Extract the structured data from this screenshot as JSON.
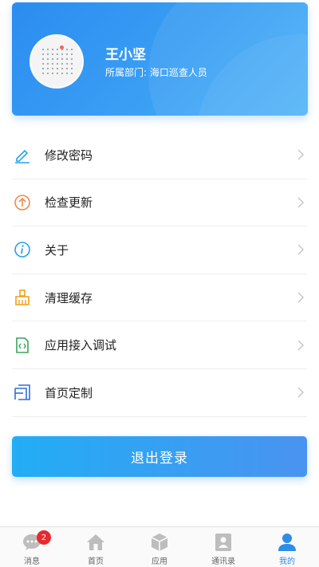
{
  "profile": {
    "name": "王小坚",
    "dept_label": "所属部门:",
    "dept_value": "海口巡查人员"
  },
  "menu": {
    "items": [
      {
        "label": "修改密码",
        "icon": "pencil-icon",
        "color": "#27a3e8"
      },
      {
        "label": "检查更新",
        "icon": "upload-arrow-icon",
        "color": "#f08a4b"
      },
      {
        "label": "关于",
        "icon": "info-icon",
        "color": "#27a3e8"
      },
      {
        "label": "清理缓存",
        "icon": "broom-icon",
        "color": "#f0a21a"
      },
      {
        "label": "应用接入调试",
        "icon": "code-file-icon",
        "color": "#3aa65a"
      },
      {
        "label": "首页定制",
        "icon": "layout-icon",
        "color": "#2f6fd6"
      }
    ]
  },
  "logout_label": "退出登录",
  "tabbar": {
    "tabs": [
      {
        "label": "消息",
        "icon": "chat-icon",
        "badge": "2"
      },
      {
        "label": "首页",
        "icon": "home-icon"
      },
      {
        "label": "应用",
        "icon": "box-icon"
      },
      {
        "label": "通讯录",
        "icon": "contacts-icon"
      },
      {
        "label": "我的",
        "icon": "person-icon",
        "active": true
      }
    ]
  },
  "colors": {
    "accent": "#2e8de6",
    "badge": "#e8292f"
  }
}
